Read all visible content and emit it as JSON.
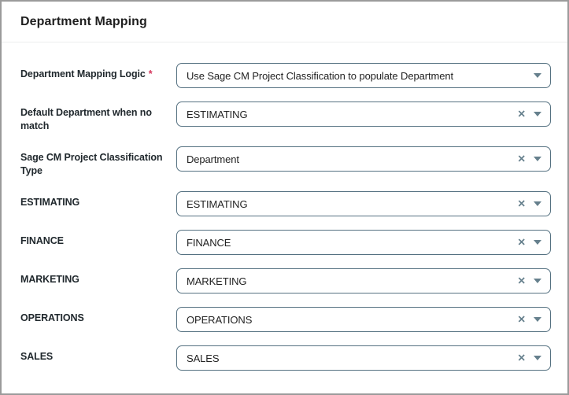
{
  "page": {
    "title": "Department Mapping"
  },
  "colors": {
    "background": "#ffffff",
    "outer_border": "#9b9b9b",
    "divider": "#eceeee",
    "title_text": "#1f1f1f",
    "label_text": "#20282d",
    "select_border": "#557181",
    "value_text": "#222222",
    "icon": "#66808d",
    "required": "#d5365c"
  },
  "icons": {
    "clear_glyph": "✕"
  },
  "fields": {
    "0": {
      "label": "Department Mapping Logic",
      "required_mark": "*",
      "value": "Use Sage CM Project Classification to populate Department"
    },
    "1": {
      "label": "Default Department when no match",
      "value": "ESTIMATING"
    },
    "2": {
      "label": "Sage CM Project Classification Type",
      "value": "Department"
    },
    "3": {
      "label": "ESTIMATING",
      "value": "ESTIMATING"
    },
    "4": {
      "label": "FINANCE",
      "value": "FINANCE"
    },
    "5": {
      "label": "MARKETING",
      "value": "MARKETING"
    },
    "6": {
      "label": "OPERATIONS",
      "value": "OPERATIONS"
    },
    "7": {
      "label": "SALES",
      "value": "SALES"
    }
  }
}
